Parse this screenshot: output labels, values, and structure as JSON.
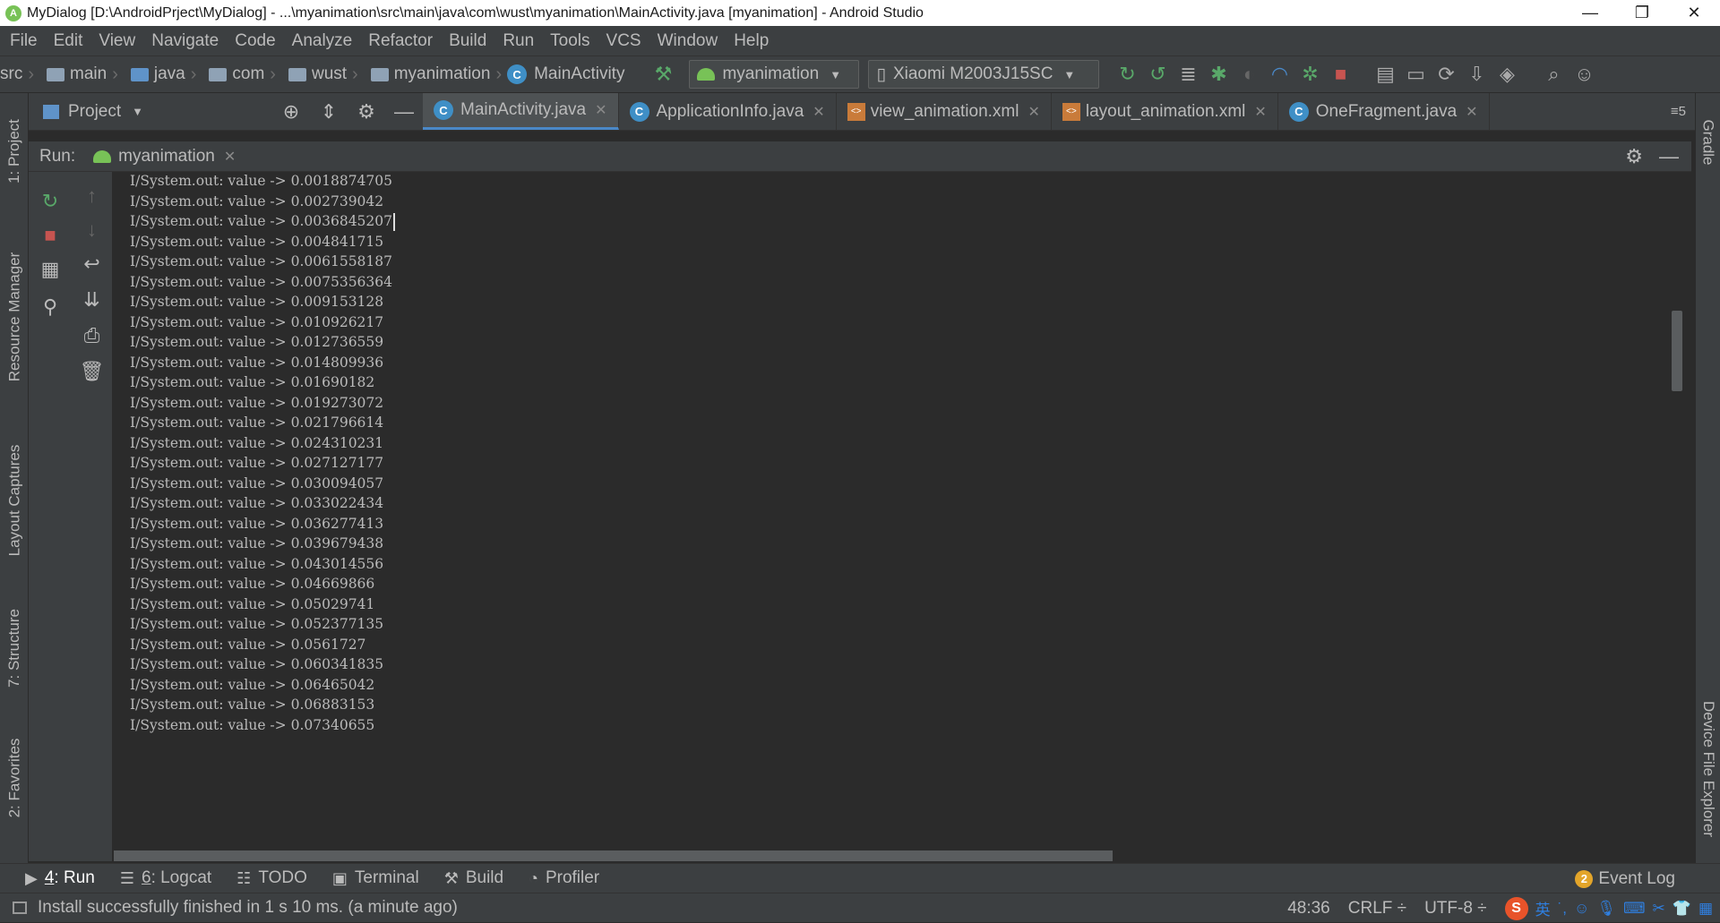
{
  "window": {
    "title": "MyDialog [D:\\AndroidPrject\\MyDialog] - ...\\myanimation\\src\\main\\java\\com\\wust\\myanimation\\MainActivity.java [myanimation] - Android Studio",
    "minimize": "—",
    "restore": "❐",
    "close": "✕"
  },
  "menu": [
    {
      "label": "File",
      "mnemonic": "F"
    },
    {
      "label": "Edit",
      "mnemonic": "E"
    },
    {
      "label": "View",
      "mnemonic": "V"
    },
    {
      "label": "Navigate",
      "mnemonic": "N"
    },
    {
      "label": "Code",
      "mnemonic": "C"
    },
    {
      "label": "Analyze",
      "mnemonic": "z"
    },
    {
      "label": "Refactor",
      "mnemonic": "R"
    },
    {
      "label": "Build",
      "mnemonic": "B"
    },
    {
      "label": "Run",
      "mnemonic": "u"
    },
    {
      "label": "Tools",
      "mnemonic": "T"
    },
    {
      "label": "VCS",
      "mnemonic": "S"
    },
    {
      "label": "Window",
      "mnemonic": "W"
    },
    {
      "label": "Help",
      "mnemonic": "H"
    }
  ],
  "breadcrumbs": {
    "src": "src",
    "main": "main",
    "java": "java",
    "com": "com",
    "wust": "wust",
    "myanimation": "myanimation",
    "mainactivity": "MainActivity"
  },
  "toolbar": {
    "run_config": "myanimation",
    "device": "Xiaomi M2003J15SC"
  },
  "project_panel": {
    "label": "Project"
  },
  "editor_tabs": [
    {
      "label": "MainActivity.java",
      "icon": "class-icon",
      "active": true
    },
    {
      "label": "ApplicationInfo.java",
      "icon": "class-icon",
      "active": false
    },
    {
      "label": "view_animation.xml",
      "icon": "xml-icon",
      "active": false
    },
    {
      "label": "layout_animation.xml",
      "icon": "xml-icon",
      "active": false
    },
    {
      "label": "OneFragment.java",
      "icon": "class-icon",
      "active": false
    }
  ],
  "tab_overflow": "≡5",
  "run_panel": {
    "label": "Run:",
    "tab": "myanimation"
  },
  "left_tool_tabs": {
    "project": "1: Project",
    "resource_manager": "Resource Manager",
    "layout_captures": "Layout Captures",
    "structure": "7: Structure",
    "favorites": "2: Favorites"
  },
  "right_tool_tabs": {
    "gradle": "Gradle",
    "device_file_explorer": "Device File Explorer"
  },
  "console": {
    "prefix": "I/System.out: value -> ",
    "values": [
      "0.0018874705",
      "0.002739042",
      "0.0036845207",
      "0.004841715",
      "0.0061558187",
      "0.0075356364",
      "0.009153128",
      "0.010926217",
      "0.012736559",
      "0.014809936",
      "0.01690182",
      "0.019273072",
      "0.021796614",
      "0.024310231",
      "0.027127177",
      "0.030094057",
      "0.033022434",
      "0.036277413",
      "0.039679438",
      "0.043014556",
      "0.04669866",
      "0.05029741",
      "0.052377135",
      "0.0561727",
      "0.060341835",
      "0.06465042",
      "0.06883153",
      "0.07340655"
    ],
    "caret_line": 2
  },
  "bottom_tabs": [
    {
      "num": "4",
      "label": ": Run",
      "icon": "▶",
      "active": true
    },
    {
      "num": "6",
      "label": ": Logcat",
      "icon": "☰",
      "active": false
    },
    {
      "num": "",
      "label": "TODO",
      "icon": "☷",
      "active": false
    },
    {
      "num": "",
      "label": "Terminal",
      "icon": "▣",
      "active": false
    },
    {
      "num": "",
      "label": "Build",
      "icon": "⚒",
      "active": false
    },
    {
      "num": "",
      "label": "Profiler",
      "icon": "◔",
      "active": false
    }
  ],
  "event_log": {
    "count": "2",
    "label": "Event Log"
  },
  "status": {
    "message": "Install successfully finished in 1 s 10 ms. (a minute ago)",
    "position": "48:36",
    "line_separator": "CRLF ÷",
    "encoding": "UTF-8 ÷",
    "ime_lang": "英"
  },
  "colors": {
    "panel": "#3c3f41",
    "editor": "#2b2b2b",
    "text": "#bbbbbb",
    "accent": "#4a88c7",
    "run_green": "#59a869",
    "stop_red": "#c75450"
  }
}
